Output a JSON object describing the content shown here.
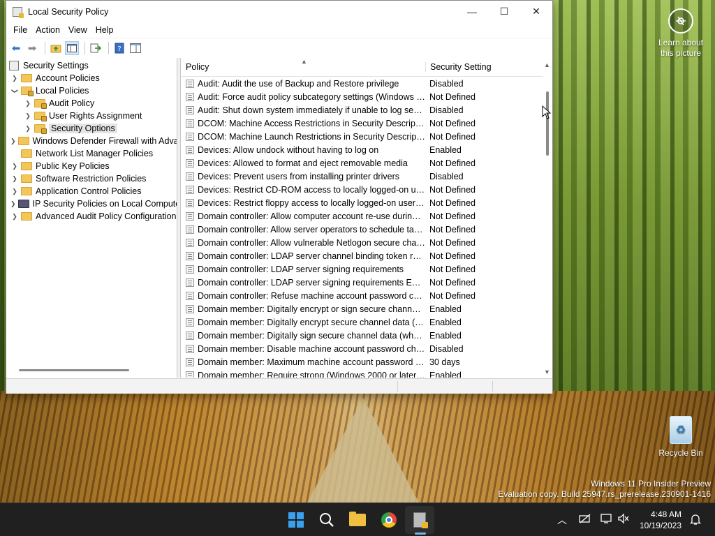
{
  "window": {
    "title": "Local Security Policy",
    "minimize": "—",
    "maximize": "☐",
    "close": "✕"
  },
  "menu": [
    "File",
    "Action",
    "View",
    "Help"
  ],
  "tree": {
    "root": "Security Settings",
    "items": [
      {
        "label": "Account Policies",
        "level": 1,
        "expander": "right"
      },
      {
        "label": "Local Policies",
        "level": 1,
        "expander": "down"
      },
      {
        "label": "Audit Policy",
        "level": 2,
        "expander": "right"
      },
      {
        "label": "User Rights Assignment",
        "level": 2,
        "expander": "right"
      },
      {
        "label": "Security Options",
        "level": 2,
        "expander": "right",
        "selected": true
      },
      {
        "label": "Windows Defender Firewall with Adva",
        "level": 1,
        "expander": "right"
      },
      {
        "label": "Network List Manager Policies",
        "level": 1,
        "expander": "none"
      },
      {
        "label": "Public Key Policies",
        "level": 1,
        "expander": "right"
      },
      {
        "label": "Software Restriction Policies",
        "level": 1,
        "expander": "right"
      },
      {
        "label": "Application Control Policies",
        "level": 1,
        "expander": "right"
      },
      {
        "label": "IP Security Policies on Local Compute",
        "level": 1,
        "expander": "right"
      },
      {
        "label": "Advanced Audit Policy Configuration",
        "level": 1,
        "expander": "right"
      }
    ]
  },
  "list": {
    "col_policy": "Policy",
    "col_setting": "Security Setting",
    "rows": [
      {
        "policy": "Audit: Audit the use of Backup and Restore privilege",
        "setting": "Disabled"
      },
      {
        "policy": "Audit: Force audit policy subcategory settings (Windows Vis...",
        "setting": "Not Defined"
      },
      {
        "policy": "Audit: Shut down system immediately if unable to log secur...",
        "setting": "Disabled"
      },
      {
        "policy": "DCOM: Machine Access Restrictions in Security Descriptor D...",
        "setting": "Not Defined"
      },
      {
        "policy": "DCOM: Machine Launch Restrictions in Security Descriptor ...",
        "setting": "Not Defined"
      },
      {
        "policy": "Devices: Allow undock without having to log on",
        "setting": "Enabled"
      },
      {
        "policy": "Devices: Allowed to format and eject removable media",
        "setting": "Not Defined"
      },
      {
        "policy": "Devices: Prevent users from installing printer drivers",
        "setting": "Disabled"
      },
      {
        "policy": "Devices: Restrict CD-ROM access to locally logged-on user ...",
        "setting": "Not Defined"
      },
      {
        "policy": "Devices: Restrict floppy access to locally logged-on user only",
        "setting": "Not Defined"
      },
      {
        "policy": "Domain controller: Allow computer account re-use during d...",
        "setting": "Not Defined"
      },
      {
        "policy": "Domain controller: Allow server operators to schedule tasks",
        "setting": "Not Defined"
      },
      {
        "policy": "Domain controller: Allow vulnerable Netlogon secure chann...",
        "setting": "Not Defined"
      },
      {
        "policy": "Domain controller: LDAP server channel binding token requi...",
        "setting": "Not Defined"
      },
      {
        "policy": "Domain controller: LDAP server signing requirements",
        "setting": "Not Defined"
      },
      {
        "policy": "Domain controller: LDAP server signing requirements Enforc...",
        "setting": "Not Defined"
      },
      {
        "policy": "Domain controller: Refuse machine account password chan...",
        "setting": "Not Defined"
      },
      {
        "policy": "Domain member: Digitally encrypt or sign secure channel d...",
        "setting": "Enabled"
      },
      {
        "policy": "Domain member: Digitally encrypt secure channel data (wh...",
        "setting": "Enabled"
      },
      {
        "policy": "Domain member: Digitally sign secure channel data (when ...",
        "setting": "Enabled"
      },
      {
        "policy": "Domain member: Disable machine account password chan...",
        "setting": "Disabled"
      },
      {
        "policy": "Domain member: Maximum machine account password age",
        "setting": "30 days"
      },
      {
        "policy": "Domain member: Require strong (Windows 2000 or later) se...",
        "setting": "Enabled"
      }
    ]
  },
  "desktop": {
    "learn_line1": "Learn about",
    "learn_line2": "this picture",
    "recycle_bin": "Recycle Bin",
    "watermark_line1": "Windows 11 Pro Insider Preview",
    "watermark_line2": "Evaluation copy. Build 25947.rs_prerelease.230901-1416"
  },
  "taskbar": {
    "time": "4:48 AM",
    "date": "10/19/2023"
  }
}
